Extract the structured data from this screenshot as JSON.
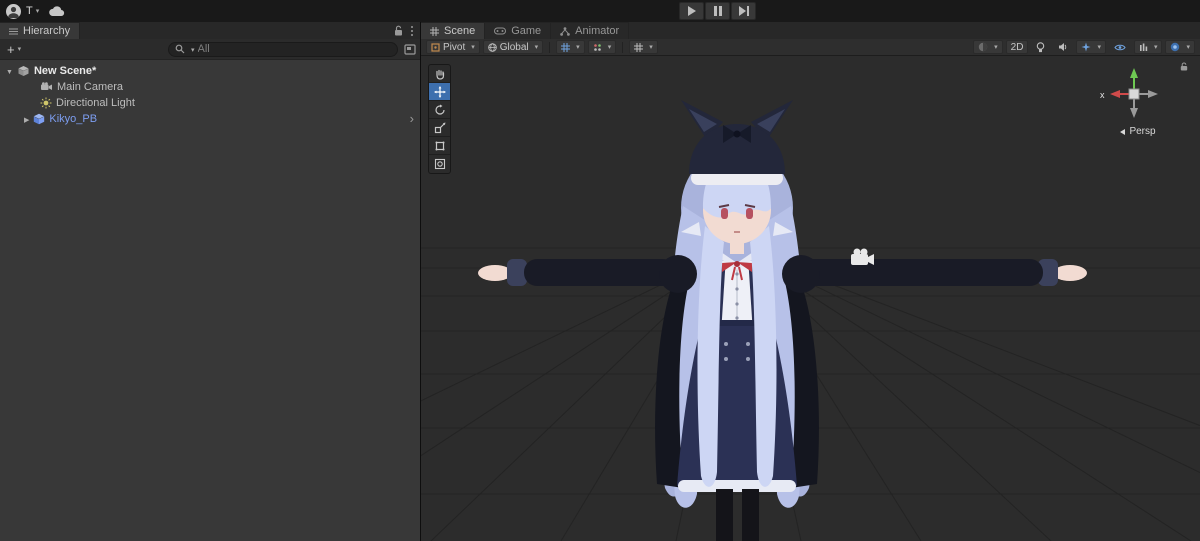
{
  "colors": {
    "prefab_text": "#7d9ef1",
    "tool_active": "#3d6fae",
    "panel_bg": "#383838",
    "scene_bg": "#2c2c2c",
    "topbar_bg": "#191919"
  },
  "topbar": {
    "account_initial": "T"
  },
  "hierarchy": {
    "tab_label": "Hierarchy",
    "add_button": "+",
    "search_placeholder": "All",
    "items": [
      {
        "label": "New Scene*"
      },
      {
        "label": "Main Camera"
      },
      {
        "label": "Directional Light"
      },
      {
        "label": "Kikyo_PB"
      }
    ]
  },
  "scene": {
    "tabs": [
      {
        "label": "Scene"
      },
      {
        "label": "Game"
      },
      {
        "label": "Animator"
      }
    ],
    "toolbar": {
      "pivot": "Pivot",
      "orientation": "Global",
      "two_d": "2D"
    },
    "gizmo": {
      "label": "Persp",
      "x_axis": "x"
    }
  }
}
